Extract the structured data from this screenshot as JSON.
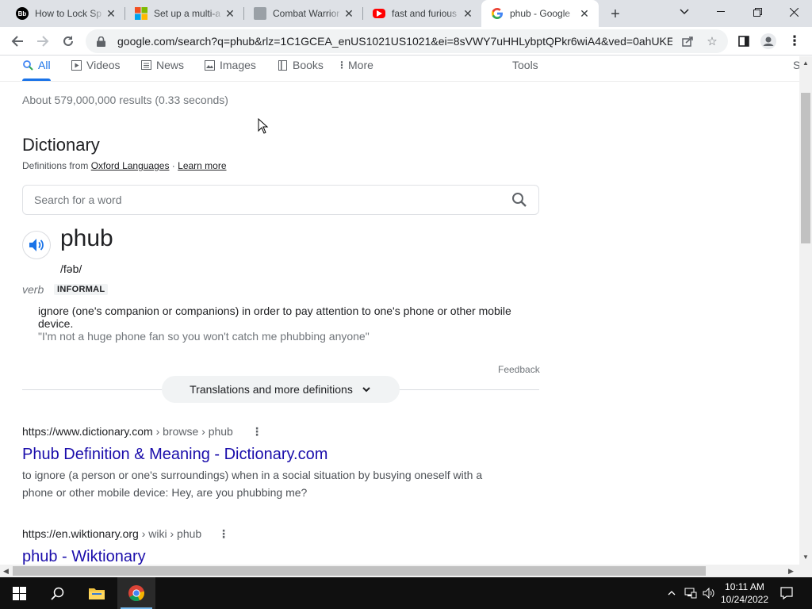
{
  "browser": {
    "tabs": [
      {
        "title": "How to Lock Sp",
        "favicon": "bb-icon"
      },
      {
        "title": "Set up a multi-a",
        "favicon": "microsoft-icon"
      },
      {
        "title": "Combat Warrior",
        "favicon": "game-icon"
      },
      {
        "title": "fast and furious",
        "favicon": "youtube-icon"
      },
      {
        "title": "phub - Google",
        "favicon": "google-icon",
        "active": true
      }
    ],
    "url": "google.com/search?q=phub&rlz=1C1GCEA_enUS1021US1021&ei=8sVWY7uHHLybptQPkr6wiA4&ved=0ahUKE..."
  },
  "search_nav": {
    "items": [
      {
        "label": "All",
        "icon": "search-icon",
        "active": true
      },
      {
        "label": "Videos",
        "icon": "play-icon"
      },
      {
        "label": "News",
        "icon": "news-icon"
      },
      {
        "label": "Images",
        "icon": "image-icon"
      },
      {
        "label": "Books",
        "icon": "book-icon"
      },
      {
        "label": "More",
        "icon": "kebab-icon"
      }
    ],
    "tools": "Tools",
    "safesearch_fragment": "S"
  },
  "results_count": "About 579,000,000 results (0.33 seconds)",
  "dictionary": {
    "title": "Dictionary",
    "source_prefix": "Definitions from",
    "source": "Oxford Languages",
    "separator": " · ",
    "learn_more": "Learn more",
    "search_placeholder": "Search for a word",
    "word": "phub",
    "phonetic": "/fəb/",
    "part_of_speech": "verb",
    "register": "INFORMAL",
    "definition": "ignore (one's companion or companions) in order to pay attention to one's phone or other mobile device.",
    "example": "\"I'm not a huge phone fan so you won't catch me phubbing anyone\"",
    "feedback": "Feedback",
    "more_button": "Translations and more definitions"
  },
  "results": [
    {
      "domain": "https://www.dictionary.com",
      "path": " › browse › phub",
      "title": "Phub Definition & Meaning - Dictionary.com",
      "snippet": "to ignore (a person or one's surroundings) when in a social situation by busying oneself with a phone or other mobile device: Hey, are you phubbing me?"
    },
    {
      "domain": "https://en.wiktionary.org",
      "path": " › wiki › phub",
      "title": "phub - Wiktionary"
    }
  ],
  "taskbar": {
    "time": "10:11 AM",
    "date": "10/24/2022"
  },
  "colors": {
    "link": "#1a0dab",
    "accent": "#1a73e8",
    "tabstrip": "#dee1e6",
    "taskbar": "#101010"
  }
}
